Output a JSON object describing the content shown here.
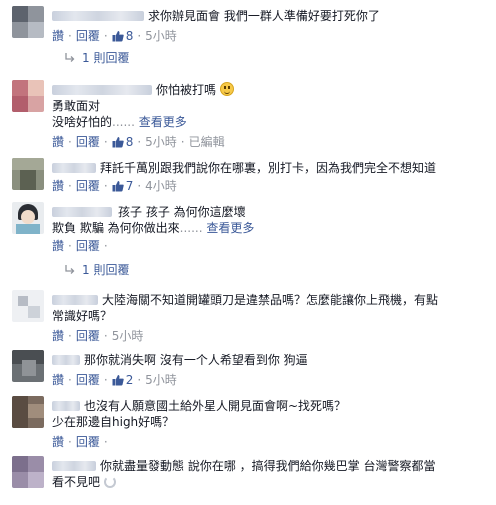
{
  "actions": {
    "like": "讚",
    "reply": "回覆",
    "sep": "·",
    "view_replies": "1 則回覆",
    "edited": "已編輯",
    "see_more": "查看更多",
    "ellipsis": "......"
  },
  "comments": [
    {
      "line1": "求你辦見面會 我們一群人準備好要打死你了",
      "likes": "8",
      "time": "5小時"
    },
    {
      "line1": "你怕被打嗎",
      "line2": "勇敢面对",
      "line3": "没啥好怕的",
      "likes": "8",
      "time": "5小時"
    },
    {
      "line1": "拜託千萬別跟我們說你在哪裏，別打卡，因為我們完全不想知道",
      "likes": "7",
      "time": "4小時"
    },
    {
      "line1": "孩子 孩子 為何你這麼壞",
      "line2": "欺負 欺騙 為何你做出來",
      "likes": "",
      "time": ""
    },
    {
      "line1": "大陸海關不知道開罐頭刀是違禁品嗎？怎麼能讓你上飛機，有點",
      "line2": "常識好嗎？",
      "likes": "",
      "time": "5小時"
    },
    {
      "line1": "那你就消失啊 沒有一个人希望看到你 狗逼",
      "likes": "2",
      "time": "5小時"
    },
    {
      "line1": "也沒有人願意國土給外星人開見面會啊~找死嗎？",
      "line2": "少在那邊自high好嗎？",
      "likes": "",
      "time": ""
    },
    {
      "line1": "你就盡量發動態 說你在哪 ，搞得我們給你幾巴掌 台灣警察都當",
      "line2": "看不見吧"
    }
  ],
  "colors": {
    "link": "#3b5998",
    "meta": "#90949c",
    "text": "#141823"
  }
}
